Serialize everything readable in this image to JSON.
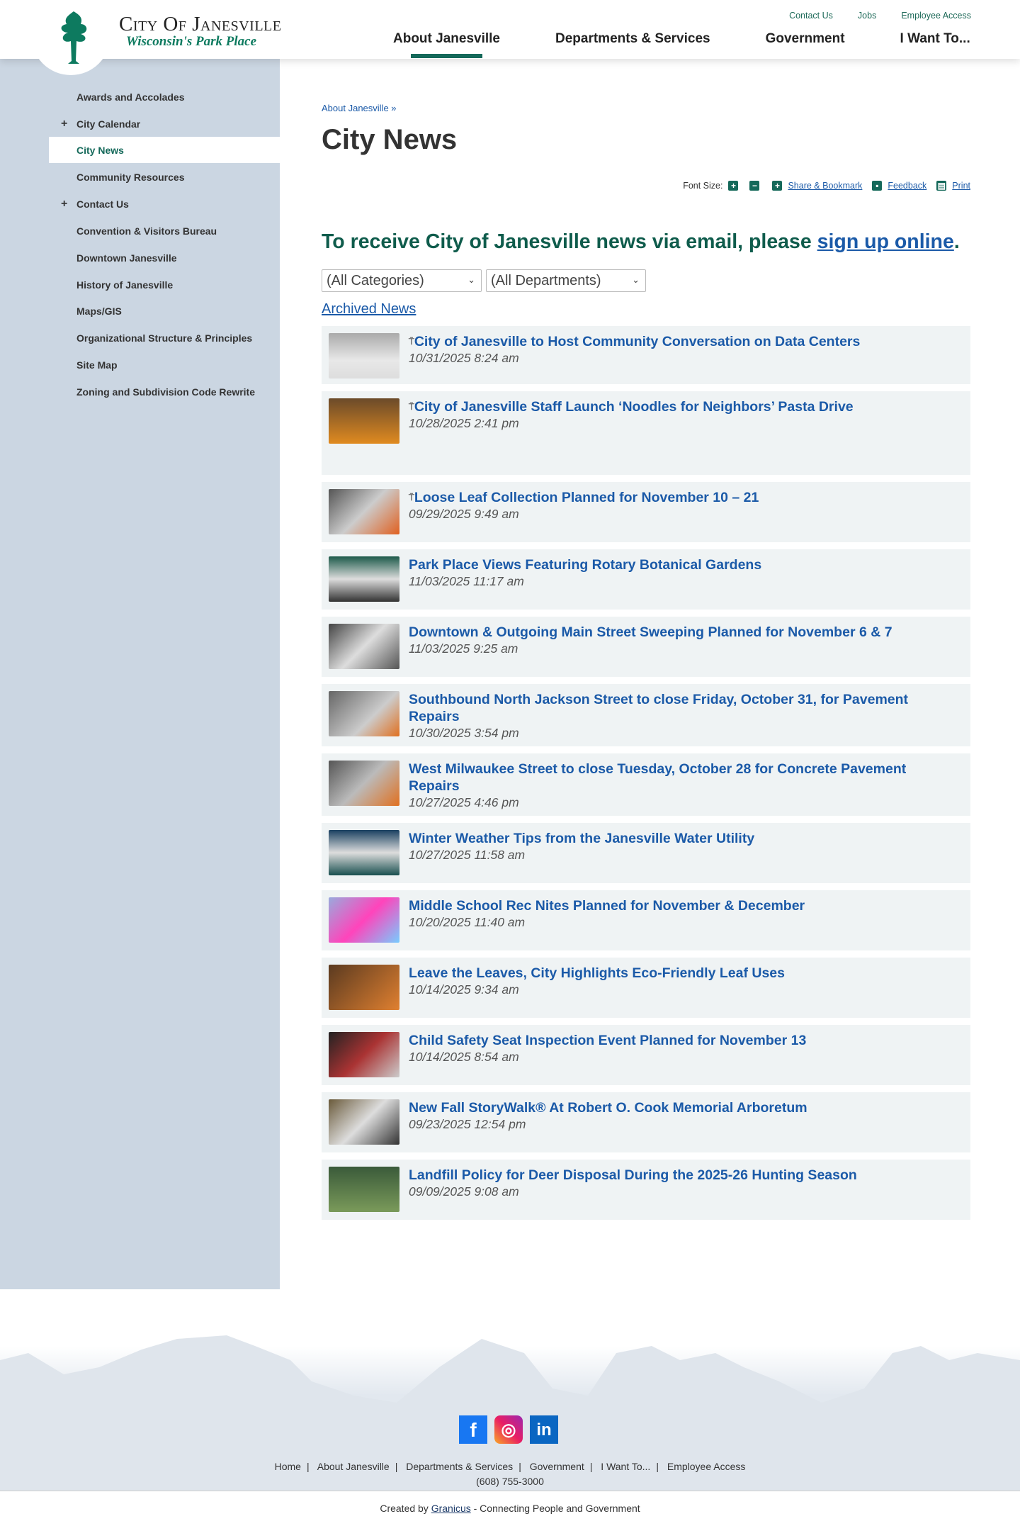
{
  "header": {
    "logo_title": "City Of Janesville",
    "logo_tagline": "Wisconsin's Park Place",
    "utility_links": [
      "Contact Us",
      "Jobs",
      "Employee Access"
    ],
    "nav": [
      "About Janesville",
      "Departments & Services",
      "Government",
      "I Want To..."
    ]
  },
  "sidebar": {
    "items": [
      {
        "label": "Awards and Accolades",
        "expand": ""
      },
      {
        "label": "City Calendar",
        "expand": "+"
      },
      {
        "label": "City News",
        "expand": ""
      },
      {
        "label": "Community Resources",
        "expand": ""
      },
      {
        "label": "Contact Us",
        "expand": "+"
      },
      {
        "label": "Convention & Visitors Bureau",
        "expand": ""
      },
      {
        "label": "Downtown Janesville",
        "expand": ""
      },
      {
        "label": "History of Janesville",
        "expand": ""
      },
      {
        "label": "Maps/GIS",
        "expand": ""
      },
      {
        "label": "Organizational Structure & Principles",
        "expand": ""
      },
      {
        "label": "Site Map",
        "expand": ""
      },
      {
        "label": "Zoning and Subdivision Code Rewrite",
        "expand": ""
      }
    ]
  },
  "main": {
    "breadcrumb": "About Janesville »",
    "title": "City News",
    "tools": {
      "font_size": "Font Size:",
      "share": "Share & Bookmark",
      "feedback": "Feedback",
      "print": "Print"
    },
    "signup_text": "To receive City of Janesville news via email, please ",
    "signup_link": "sign up online",
    "signup_end": ".",
    "category_select": "(All Categories)",
    "department_select": "(All Departments)",
    "archived": "Archived News",
    "news": [
      {
        "title": "City of Janesville to Host Community Conversation on Data Centers",
        "date": "10/31/2025 8:24 am",
        "pinned": true
      },
      {
        "title": "City of Janesville Staff Launch ‘Noodles for Neighbors’ Pasta Drive",
        "date": "10/28/2025 2:41 pm",
        "pinned": true
      },
      {
        "title": "Loose Leaf Collection Planned for November 10 – 21",
        "date": "09/29/2025 9:49 am",
        "pinned": true
      },
      {
        "title": "Park Place Views Featuring Rotary Botanical Gardens",
        "date": "11/03/2025 11:17 am",
        "pinned": false
      },
      {
        "title": "Downtown & Outgoing Main Street Sweeping Planned for November 6 & 7",
        "date": "11/03/2025 9:25 am",
        "pinned": false
      },
      {
        "title": "Southbound North Jackson Street to close Friday, October 31, for Pavement Repairs",
        "date": "10/30/2025 3:54 pm",
        "pinned": false
      },
      {
        "title": "West Milwaukee Street to close Tuesday, October 28 for Concrete Pavement Repairs",
        "date": "10/27/2025 4:46 pm",
        "pinned": false
      },
      {
        "title": "Winter Weather Tips from the Janesville Water Utility",
        "date": "10/27/2025 11:58 am",
        "pinned": false
      },
      {
        "title": "Middle School Rec Nites Planned for November & December",
        "date": "10/20/2025 11:40 am",
        "pinned": false
      },
      {
        "title": "Leave the Leaves, City Highlights Eco-Friendly Leaf Uses",
        "date": "10/14/2025 9:34 am",
        "pinned": false
      },
      {
        "title": "Child Safety Seat Inspection Event Planned for November 13",
        "date": "10/14/2025 8:54 am",
        "pinned": false
      },
      {
        "title": "New Fall StoryWalk® At Robert O. Cook Memorial Arboretum",
        "date": "09/23/2025 12:54 pm",
        "pinned": false
      },
      {
        "title": "Landfill Policy for Deer Disposal During the 2025-26 Hunting Season",
        "date": "09/09/2025 9:08 am",
        "pinned": false
      }
    ]
  },
  "footer": {
    "links": [
      "Home",
      "About Janesville",
      "Departments & Services",
      "Government",
      "I Want To...",
      "Employee Access"
    ],
    "phone": "(608) 755-3000",
    "credit_pre": "Created by ",
    "credit_link": "Granicus",
    "credit_post": " - Connecting People and Government"
  },
  "colors": {
    "green": "#15695a",
    "link": "#1b5aa8",
    "sidebar": "#cbd6e2"
  }
}
